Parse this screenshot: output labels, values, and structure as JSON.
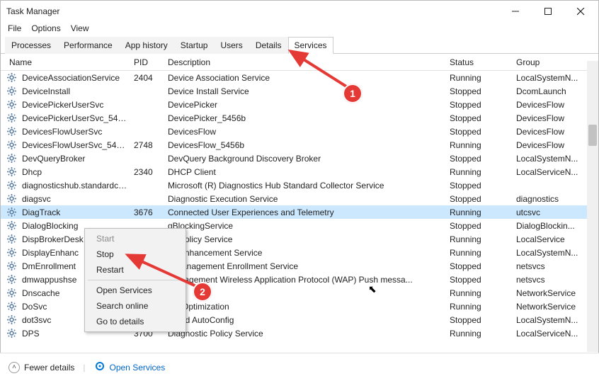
{
  "window": {
    "title": "Task Manager"
  },
  "menubar": [
    "File",
    "Options",
    "View"
  ],
  "tabs": {
    "items": [
      "Processes",
      "Performance",
      "App history",
      "Startup",
      "Users",
      "Details",
      "Services"
    ],
    "active": "Services"
  },
  "columns": {
    "name": "Name",
    "pid": "PID",
    "desc": "Description",
    "status": "Status",
    "group": "Group"
  },
  "rows": [
    {
      "name": "DeviceAssociationService",
      "pid": "2404",
      "desc": "Device Association Service",
      "status": "Running",
      "group": "LocalSystemN...",
      "sel": false
    },
    {
      "name": "DeviceInstall",
      "pid": "",
      "desc": "Device Install Service",
      "status": "Stopped",
      "group": "DcomLaunch",
      "sel": false
    },
    {
      "name": "DevicePickerUserSvc",
      "pid": "",
      "desc": "DevicePicker",
      "status": "Stopped",
      "group": "DevicesFlow",
      "sel": false
    },
    {
      "name": "DevicePickerUserSvc_5456b",
      "pid": "",
      "desc": "DevicePicker_5456b",
      "status": "Stopped",
      "group": "DevicesFlow",
      "sel": false
    },
    {
      "name": "DevicesFlowUserSvc",
      "pid": "",
      "desc": "DevicesFlow",
      "status": "Stopped",
      "group": "DevicesFlow",
      "sel": false
    },
    {
      "name": "DevicesFlowUserSvc_5456b",
      "pid": "2748",
      "desc": "DevicesFlow_5456b",
      "status": "Running",
      "group": "DevicesFlow",
      "sel": false
    },
    {
      "name": "DevQueryBroker",
      "pid": "",
      "desc": "DevQuery Background Discovery Broker",
      "status": "Stopped",
      "group": "LocalSystemN...",
      "sel": false
    },
    {
      "name": "Dhcp",
      "pid": "2340",
      "desc": "DHCP Client",
      "status": "Running",
      "group": "LocalServiceN...",
      "sel": false
    },
    {
      "name": "diagnosticshub.standardco...",
      "pid": "",
      "desc": "Microsoft (R) Diagnostics Hub Standard Collector Service",
      "status": "Stopped",
      "group": "",
      "sel": false
    },
    {
      "name": "diagsvc",
      "pid": "",
      "desc": "Diagnostic Execution Service",
      "status": "Stopped",
      "group": "diagnostics",
      "sel": false
    },
    {
      "name": "DiagTrack",
      "pid": "3676",
      "desc": "Connected User Experiences and Telemetry",
      "status": "Running",
      "group": "utcsvc",
      "sel": true
    },
    {
      "name": "DialogBlocking",
      "pid": "",
      "desc": "        gBlockingService",
      "status": "Stopped",
      "group": "DialogBlockin...",
      "sel": false
    },
    {
      "name": "DispBrokerDesk",
      "pid": "",
      "desc": "        ay Policy Service",
      "status": "Running",
      "group": "LocalService",
      "sel": false
    },
    {
      "name": "DisplayEnhanc",
      "pid": "",
      "desc": "        ay Enhancement Service",
      "status": "Running",
      "group": "LocalSystemN...",
      "sel": false
    },
    {
      "name": "DmEnrollment",
      "pid": "",
      "desc": "        e Management Enrollment Service",
      "status": "Stopped",
      "group": "netsvcs",
      "sel": false
    },
    {
      "name": "dmwappushse",
      "pid": "",
      "desc": "         Management Wireless Application Protocol (WAP) Push messa...",
      "status": "Stopped",
      "group": "netsvcs",
      "sel": false
    },
    {
      "name": "Dnscache",
      "pid": "",
      "desc": "",
      "status": "Running",
      "group": "NetworkService",
      "sel": false
    },
    {
      "name": "DoSvc",
      "pid": "",
      "desc": "         ery Optimization",
      "status": "Running",
      "group": "NetworkService",
      "sel": false
    },
    {
      "name": "dot3svc",
      "pid": "",
      "desc": "Wired AutoConfig",
      "status": "Stopped",
      "group": "LocalSystemN...",
      "sel": false
    },
    {
      "name": "DPS",
      "pid": "3700",
      "desc": "Diagnostic Policy Service",
      "status": "Running",
      "group": "LocalServiceN...",
      "sel": false
    }
  ],
  "context_menu": {
    "items": [
      "Start",
      "Stop",
      "Restart",
      "__sep__",
      "Open Services",
      "Search online",
      "Go to details"
    ],
    "disabled": [
      "Start"
    ]
  },
  "footer": {
    "fewer": "Fewer details",
    "open": "Open Services"
  },
  "badges": {
    "one": "1",
    "two": "2"
  }
}
